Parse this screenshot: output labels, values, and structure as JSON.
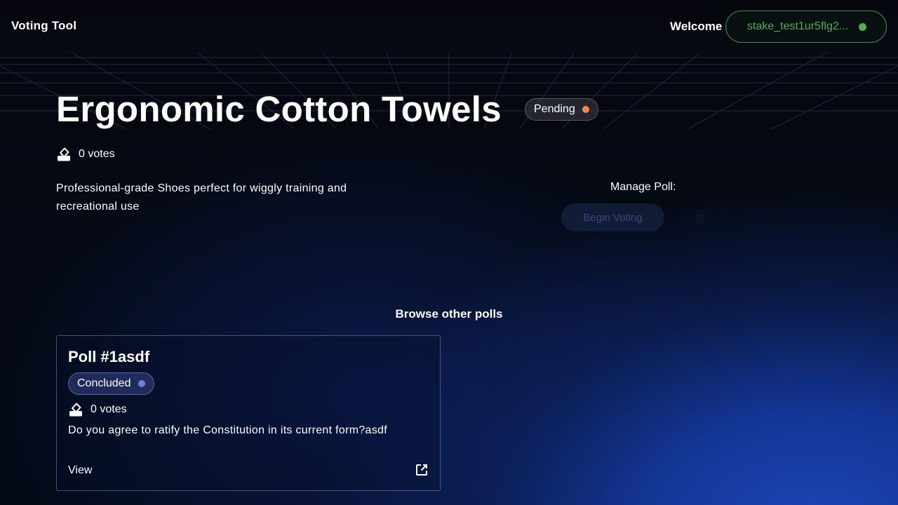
{
  "header": {
    "brand": "Voting Tool",
    "welcome": "Welcome",
    "wallet_address": "stake_test1ur5flg2...",
    "wallet_status_color": "#4caf50"
  },
  "poll": {
    "title": "Ergonomic Cotton Towels",
    "status": "Pending",
    "status_color": "#f08a4b",
    "votes": "0 votes",
    "description": "Professional-grade Shoes perfect for wiggly training and recreational use",
    "manage_label": "Manage Poll:",
    "begin_voting_label": "Begin Voting",
    "delete_icon": "trash-icon"
  },
  "browse": {
    "title": "Browse other polls",
    "polls": [
      {
        "title": "Poll #1asdf",
        "status": "Concluded",
        "status_color": "#6f82d8",
        "votes": "0 votes",
        "question": "Do you agree to ratify the Constitution in its current form?asdf",
        "view_label": "View",
        "link_icon": "external-link-icon"
      }
    ]
  },
  "colors": {
    "accent_blue": "#1c46b8",
    "wallet_green": "#49b058",
    "pending_orange": "#f08a4b"
  }
}
